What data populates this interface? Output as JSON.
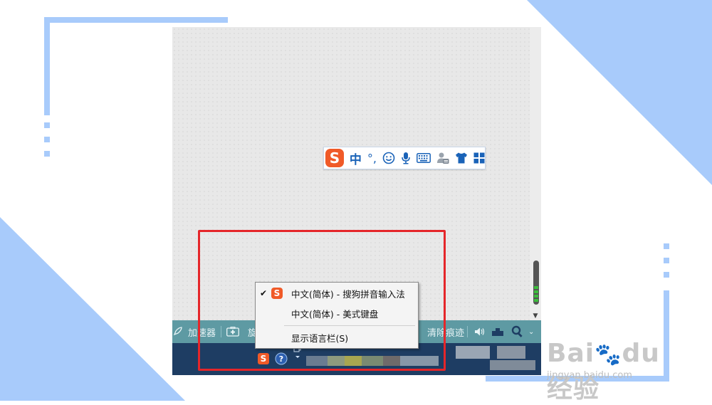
{
  "colors": {
    "accent_blue": "#a8cbfb",
    "highlight_red": "#e5262a",
    "sogou_orange": "#f05a28",
    "ime_icon_blue": "#1a63b8",
    "taskbar_top": "#5e9aa3",
    "taskbar_bottom": "#1e3d63"
  },
  "ime_toolbar": {
    "logo_letter": "S",
    "mode_label": "中",
    "punct_label": "°,",
    "icons": [
      "smiley-icon",
      "microphone-icon",
      "keyboard-icon",
      "user-icon",
      "skin-shirt-icon",
      "toolbox-grid-icon"
    ]
  },
  "taskbar": {
    "left_items": [
      "加速器",
      "旋"
    ],
    "clean_trace_label": "清除痕迹",
    "tray_icons": [
      "sogou-tray-icon",
      "help-icon",
      "language-bar-restore-icon"
    ]
  },
  "context_menu": {
    "items": [
      {
        "label": "中文(简体) - 搜狗拼音输入法",
        "checked": true,
        "icon": "sogou-icon"
      },
      {
        "label": "中文(简体) - 美式键盘",
        "checked": false
      },
      {
        "label": "显示语言栏(S)",
        "checked": false
      }
    ],
    "check_glyph": "✔"
  },
  "watermark": {
    "brand": "Bai",
    "brand_suffix": "du",
    "brand_cn": "经验",
    "url": "jingyan.baidu.com"
  }
}
